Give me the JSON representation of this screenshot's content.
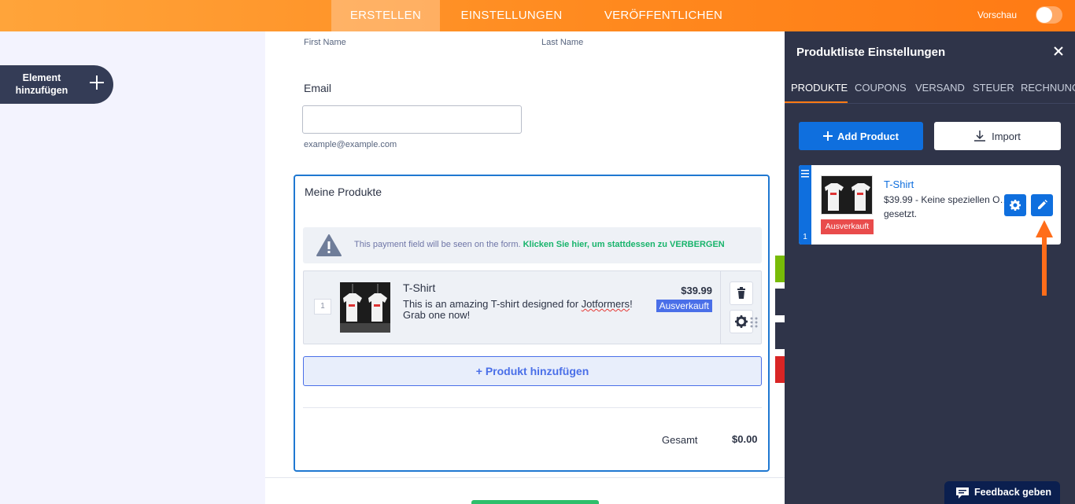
{
  "topbar": {
    "tabs": [
      {
        "label": "ERSTELLEN",
        "active": true
      },
      {
        "label": "EINSTELLUNGEN",
        "active": false
      },
      {
        "label": "VERÖFFENTLICHEN",
        "active": false
      }
    ],
    "preview_label": "Vorschau",
    "preview_on": false,
    "color_left": "#ffa43a",
    "color_right": "#ff7a14"
  },
  "left": {
    "add_element_label": "Element hinzufügen"
  },
  "form": {
    "first_name_label": "First Name",
    "last_name_label": "Last Name",
    "email_label": "Email",
    "email_value": "",
    "email_hint": "example@example.com",
    "products": {
      "title": "Meine Produkte",
      "notice_text": "This payment field will be seen on the form.",
      "notice_link": "Klicken Sie hier, um stattdessen zu VERBERGEN",
      "items": [
        {
          "index": "1",
          "name": "T-Shirt",
          "desc_before": "This is an amazing T-shirt designed for ",
          "desc_flagged": "Jotformers",
          "desc_after": "! Grab one now!",
          "price": "$39.99",
          "badge": "Ausverkauft"
        }
      ],
      "add_label": "+ Produkt hinzufügen",
      "total_label": "Gesamt",
      "total_value": "$0.00"
    }
  },
  "panel": {
    "title": "Produktliste Einstellungen",
    "tabs": [
      {
        "label": "PRODUKTE",
        "active": true
      },
      {
        "label": "COUPONS",
        "active": false
      },
      {
        "label": "VERSAND",
        "active": false
      },
      {
        "label": "STEUER",
        "active": false
      },
      {
        "label": "RECHNUNG",
        "active": false
      }
    ],
    "add_product_label": "Add Product",
    "import_label": "Import",
    "card": {
      "index": "1",
      "name": "T-Shirt",
      "desc": "$39.99 - Keine speziellen O… gesetzt.",
      "badge": "Ausverkauft"
    }
  },
  "feedback_label": "Feedback geben",
  "colors": {
    "accent_orange": "#ff7a14",
    "primary_blue": "#0f6fde",
    "panel_bg": "#2f3449",
    "sold_out_red": "#e94b4b",
    "notice_green": "#18b46b"
  }
}
